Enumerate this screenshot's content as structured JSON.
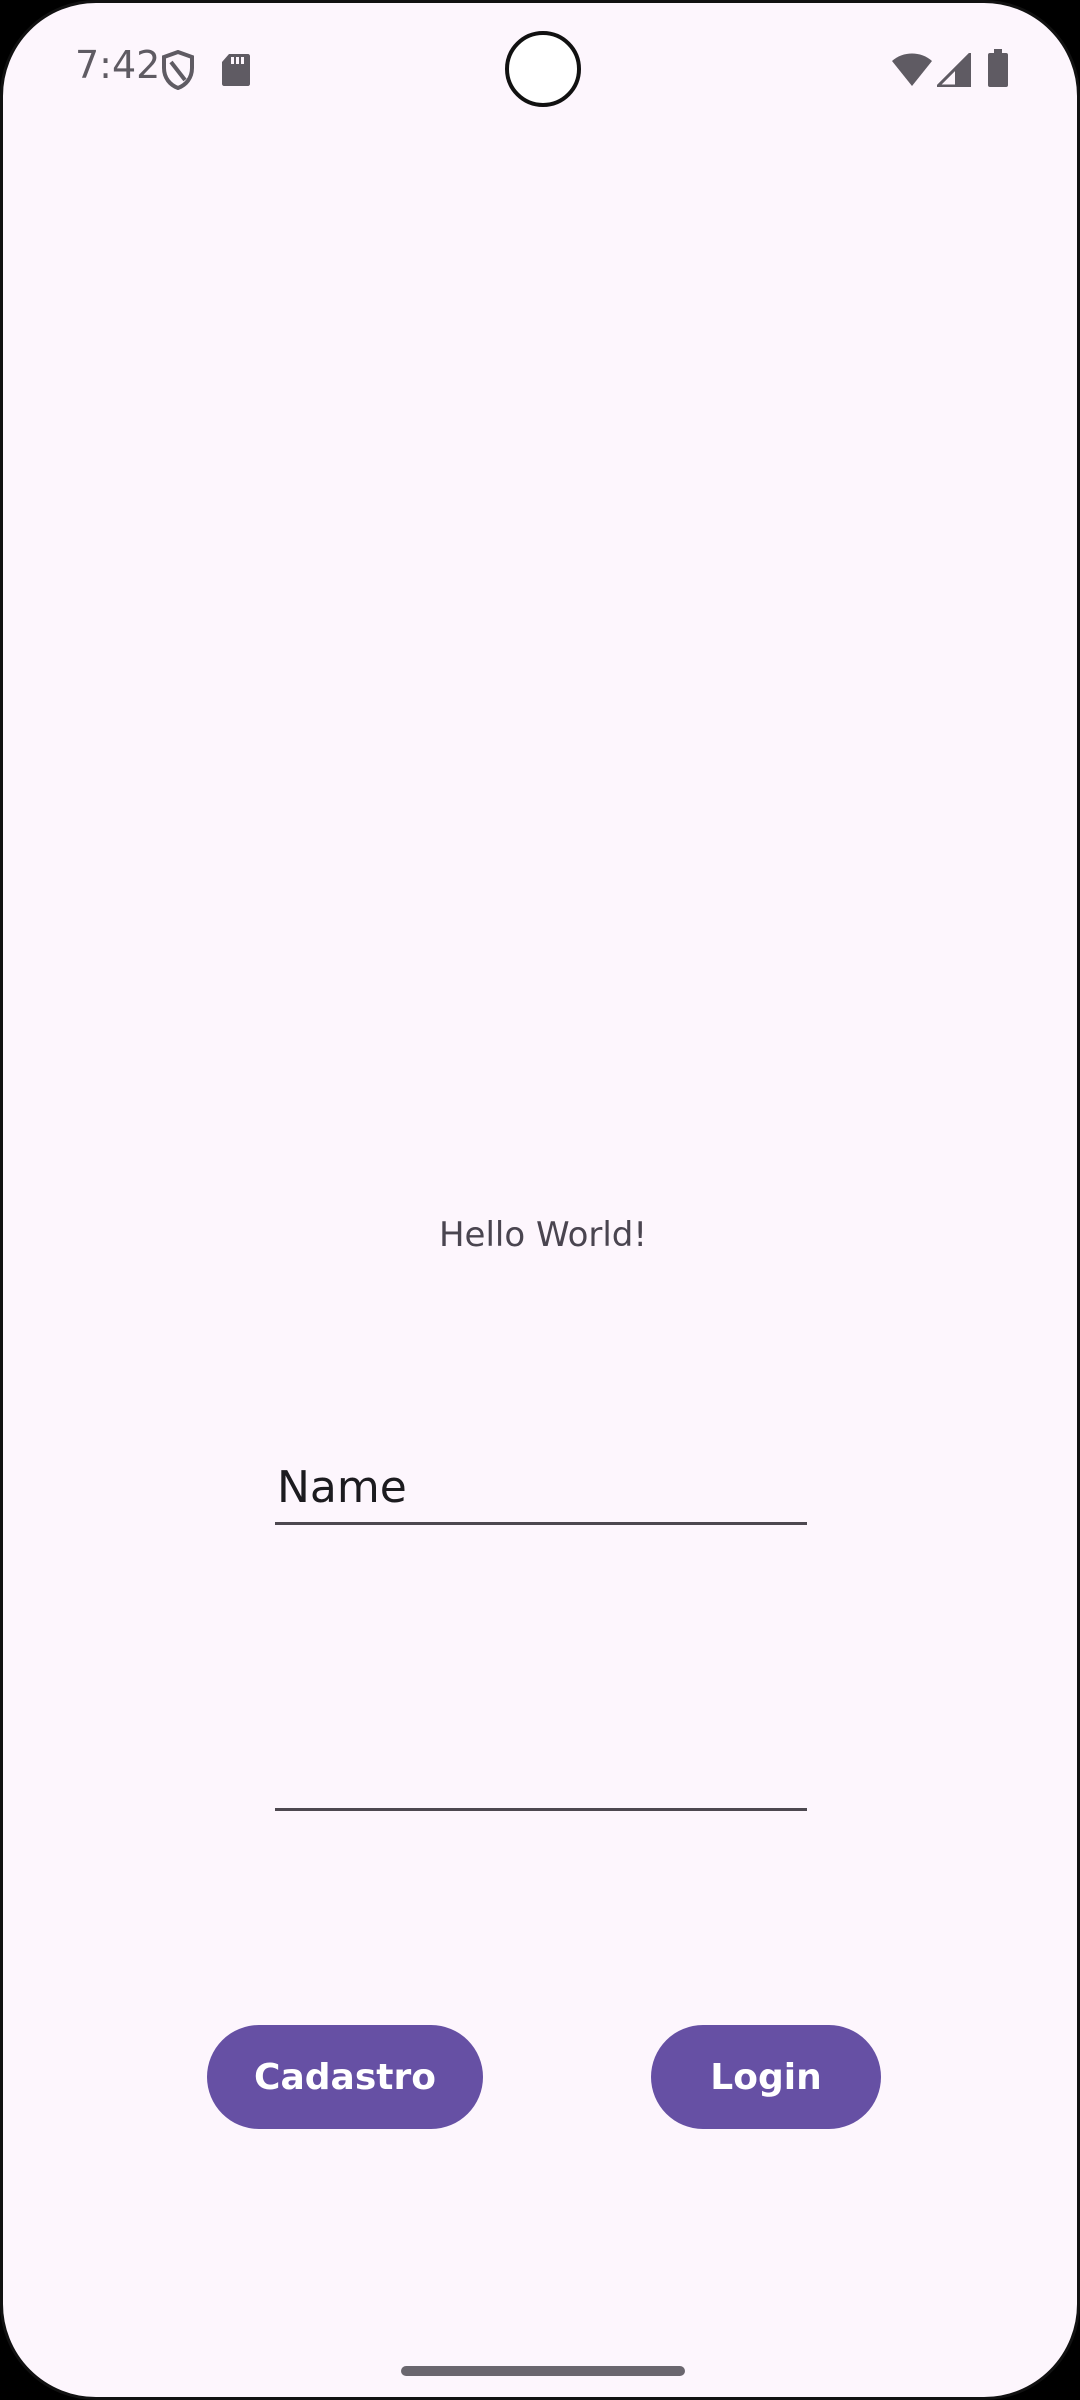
{
  "status_bar": {
    "time": "7:42",
    "icons": [
      "shield-icon",
      "sd-card-icon",
      "wifi-icon",
      "signal-icon",
      "battery-icon"
    ]
  },
  "main": {
    "greeting": "Hello World!",
    "name_field": {
      "value": "",
      "placeholder": "Name"
    },
    "second_field": {
      "value": "",
      "placeholder": ""
    },
    "buttons": {
      "cadastro_label": "Cadastro",
      "login_label": "Login"
    }
  },
  "colors": {
    "background": "#fdf6fd",
    "primary": "#6650a4",
    "on_primary": "#ffffff",
    "text": "#1c1b1f"
  }
}
